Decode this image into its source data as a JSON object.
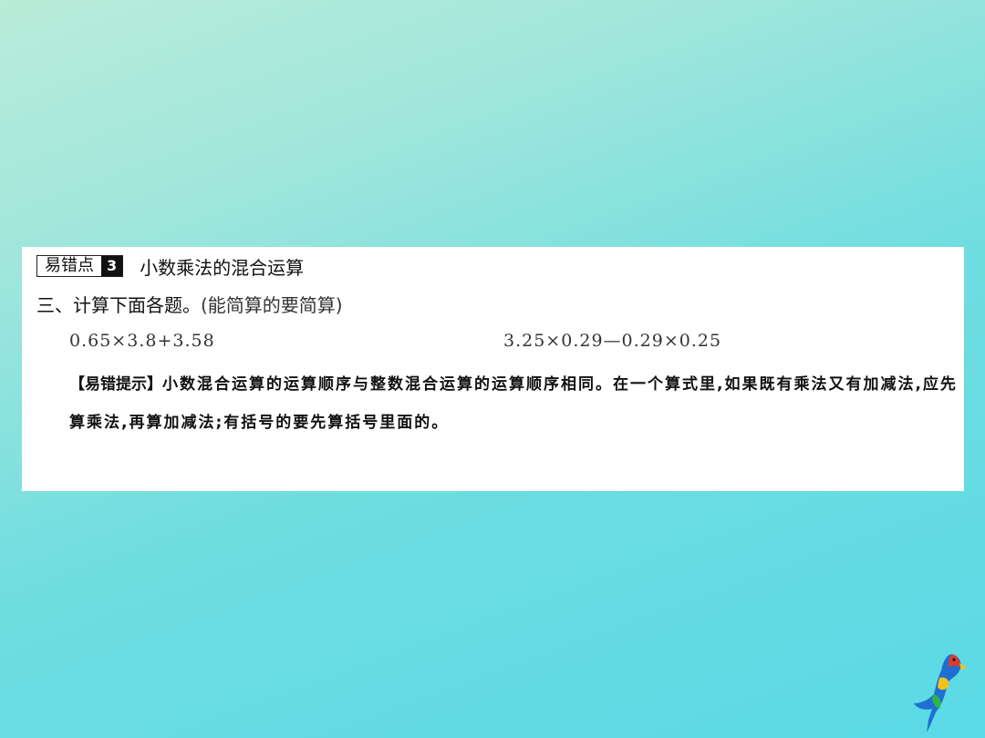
{
  "page": {
    "background_colors": [
      "#b9ecd9",
      "#5ad9e6"
    ]
  },
  "section": {
    "tag_label": "易错点",
    "tag_number": "3",
    "title": "小数乘法的混合运算"
  },
  "question": {
    "heading": "三、计算下面各题。",
    "note": "(能简算的要简算)"
  },
  "expressions": [
    "0.65×3.8+3.58",
    "3.25×0.29—0.29×0.25"
  ],
  "hint": {
    "label": "【易错提示】",
    "text": "小数混合运算的运算顺序与整数混合运算的运算顺序相同。在一个算式里,如果既有乘法又有加减法,应先算乘法,再算加减法;有括号的要先算括号里面的。"
  },
  "decoration": {
    "parrot_icon": "parrot-icon"
  }
}
